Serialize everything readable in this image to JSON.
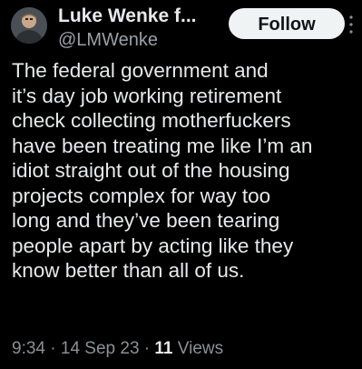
{
  "author": {
    "display_name": "Luke Wenke f...",
    "handle": "@LMWenke",
    "avatar_icon": "user-avatar"
  },
  "actions": {
    "follow_label": "Follow",
    "more_icon": "vertical-dots-icon"
  },
  "tweet": {
    "text": "The federal government and\nit’s day job working retirement\ncheck collecting motherfuckers\nhave been treating me like I’m an\nidiot straight out of the housing\nprojects complex for way too\nlong and they’ve been tearing\npeople apart by acting like they\nknow better than all of us."
  },
  "meta": {
    "time": "9:34",
    "separator_1": " · ",
    "date": "14 Sep 23",
    "separator_2": " · ",
    "views_count": "11",
    "views_label": " Views"
  },
  "colors": {
    "background": "#000000",
    "text_primary": "#e7e9ea",
    "text_secondary": "#8b9096",
    "button_bg": "#eff3f4",
    "button_text": "#0f1419"
  }
}
